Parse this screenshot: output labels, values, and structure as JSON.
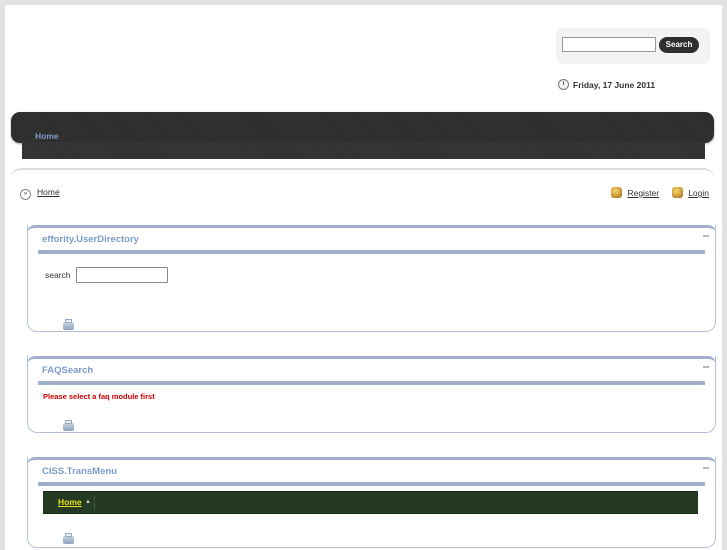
{
  "header": {
    "search": {
      "value": "",
      "button_label": "Search"
    },
    "date": "Friday, 17 June 2011"
  },
  "nav": {
    "items": [
      {
        "label": "Home"
      }
    ]
  },
  "breadcrumb": {
    "home": "Home"
  },
  "user_links": {
    "register": "Register",
    "login": "Login"
  },
  "modules": [
    {
      "title": "effority.UserDirectory",
      "search_label": "search",
      "search_value": ""
    },
    {
      "title": "FAQSearch",
      "message": "Please select a faq module first"
    },
    {
      "title": "CISS.TransMenu",
      "menu": [
        {
          "label": "Home",
          "arrow": "▲"
        }
      ]
    }
  ],
  "colors": {
    "module_title": "#7c9ccb",
    "module_border": "#9fb0c8",
    "error_text": "#cc0000",
    "transmenu_bg": "#253a22",
    "transmenu_link": "#e8e21a",
    "navbar_bg": "#333333"
  }
}
